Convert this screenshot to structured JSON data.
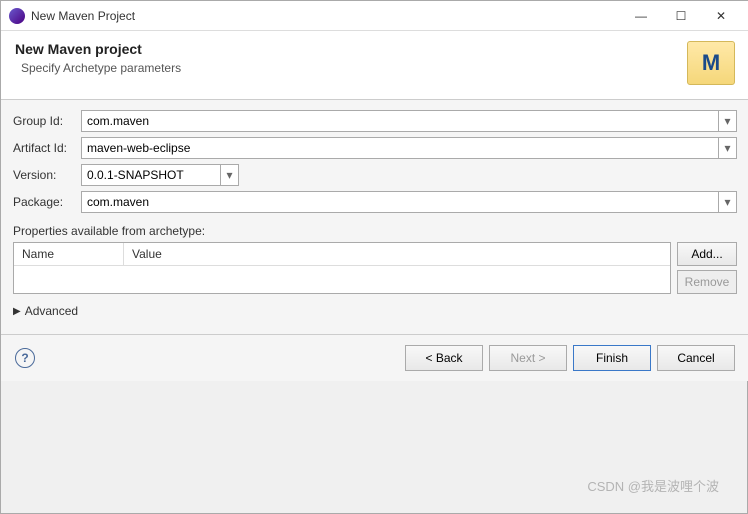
{
  "window": {
    "title": "New Maven Project",
    "minimize": "—",
    "maximize": "☐",
    "close": "✕"
  },
  "header": {
    "title": "New Maven project",
    "subtitle": "Specify Archetype parameters",
    "icon_letter": "M"
  },
  "form": {
    "group_id_label": "Group Id:",
    "group_id_value": "com.maven",
    "artifact_id_label": "Artifact Id:",
    "artifact_id_value": "maven-web-eclipse",
    "version_label": "Version:",
    "version_value": "0.0.1-SNAPSHOT",
    "package_label": "Package:",
    "package_value": "com.maven"
  },
  "properties": {
    "heading": "Properties available from archetype:",
    "col_name": "Name",
    "col_value": "Value",
    "add_label": "Add...",
    "remove_label": "Remove"
  },
  "advanced_label": "Advanced",
  "footer": {
    "help": "?",
    "back": "< Back",
    "next": "Next >",
    "finish": "Finish",
    "cancel": "Cancel"
  },
  "watermark": "CSDN @我是波哩个波"
}
